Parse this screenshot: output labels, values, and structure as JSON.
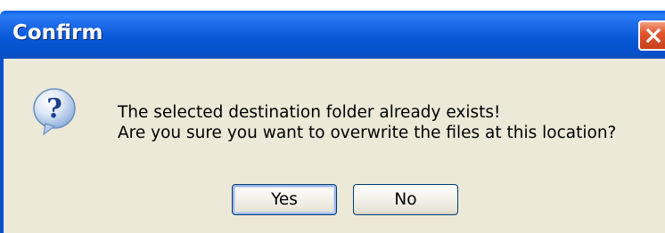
{
  "window": {
    "title": "Confirm",
    "close_icon": "close-icon"
  },
  "dialog": {
    "icon": "question-icon",
    "message_line1": "The selected destination folder already exists!",
    "message_line2": "Are you sure you want to overwrite the files at this location?"
  },
  "buttons": {
    "yes_label": "Yes",
    "no_label": "No"
  },
  "colors": {
    "titlebar": "#0a5fe0",
    "body": "#ece9d8",
    "close_button": "#e2562d"
  }
}
